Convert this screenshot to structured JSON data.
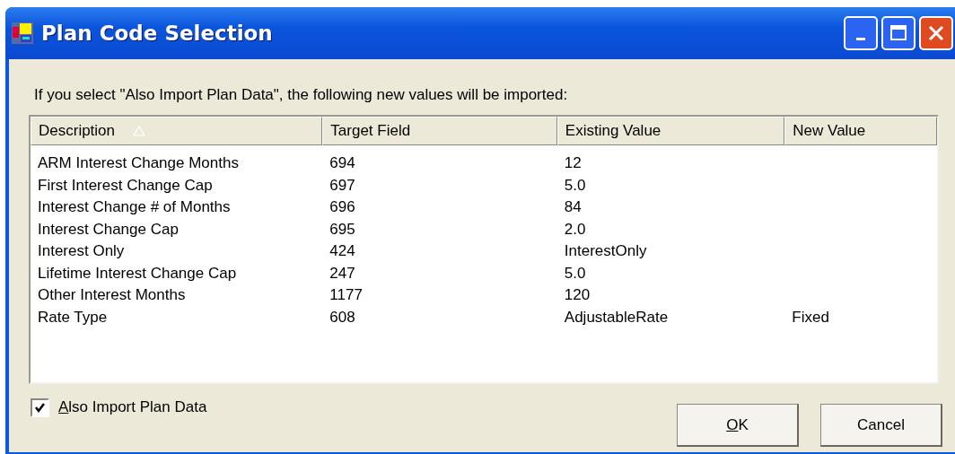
{
  "window": {
    "title": "Plan Code Selection"
  },
  "message": "If you select \"Also Import Plan Data\", the following new values will be imported:",
  "table": {
    "columns": [
      {
        "label": "Description",
        "sorted": true
      },
      {
        "label": "Target Field",
        "sorted": false
      },
      {
        "label": "Existing Value",
        "sorted": false
      },
      {
        "label": "New Value",
        "sorted": false
      }
    ],
    "rows": [
      [
        "ARM Interest Change Months",
        "694",
        "12",
        ""
      ],
      [
        "First Interest Change Cap",
        "697",
        "5.0",
        ""
      ],
      [
        "Interest Change # of Months",
        "696",
        "84",
        ""
      ],
      [
        "Interest Change Cap",
        "695",
        "2.0",
        ""
      ],
      [
        "Interest Only",
        "424",
        "InterestOnly",
        ""
      ],
      [
        "Lifetime Interest Change Cap",
        "247",
        "5.0",
        ""
      ],
      [
        "Other Interest Months",
        "1177",
        "120",
        ""
      ],
      [
        "Rate Type",
        "608",
        "AdjustableRate",
        "Fixed"
      ]
    ]
  },
  "import_checkbox": {
    "label": "Also Import Plan Data",
    "checked": true
  },
  "buttons": [
    "OK",
    "Cancel"
  ]
}
